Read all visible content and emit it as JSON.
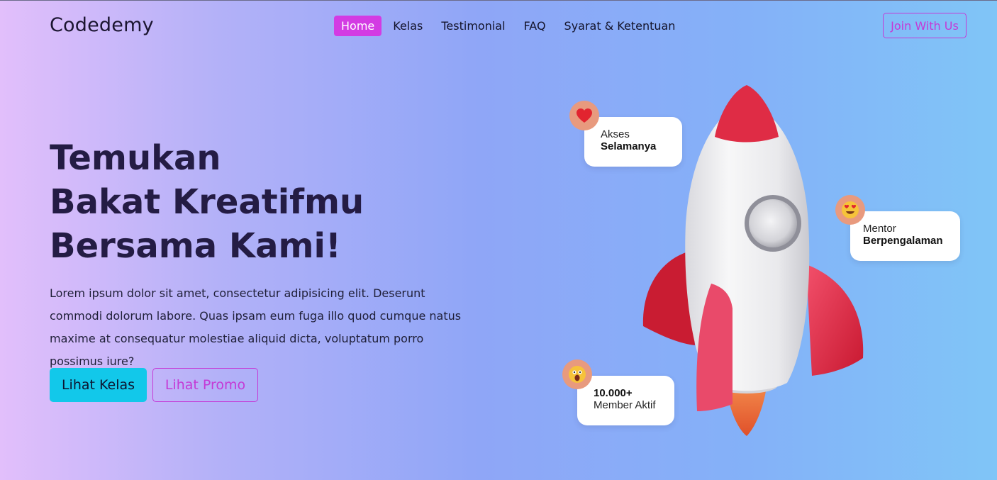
{
  "brand": "Codedemy",
  "nav": {
    "items": [
      "Home",
      "Kelas",
      "Testimonial",
      "FAQ",
      "Syarat & Ketentuan"
    ],
    "active": "Home"
  },
  "join_label": "Join With Us",
  "hero": {
    "title_lines": [
      "Temukan",
      "Bakat Kreatifmu",
      "Bersama Kami!"
    ],
    "description": "Lorem ipsum dolor sit amet, consectetur adipisicing elit. Deserunt commodi dolorum labore. Quas ipsam eum fuga illo quod cumque natus maxime at consequatur molestiae aliquid dicta, voluptatum porro possimus iure?",
    "primary_button": "Lihat Kelas",
    "secondary_button": "Lihat Promo"
  },
  "badges": {
    "akses": {
      "line1": "Akses",
      "line2": "Selamanya",
      "icon": "heart-icon"
    },
    "mentor": {
      "line1": "Mentor",
      "line2": "Berpengalaman",
      "icon": "heart-eyes-emoji-icon"
    },
    "member": {
      "line1": "10.000+",
      "line2": "Member Aktif",
      "icon": "screaming-emoji-icon"
    }
  },
  "colors": {
    "accent": "#d33be3",
    "primary_button": "#12c8ea",
    "rocket_red": "#e02a45",
    "rocket_body": "#ededed"
  }
}
